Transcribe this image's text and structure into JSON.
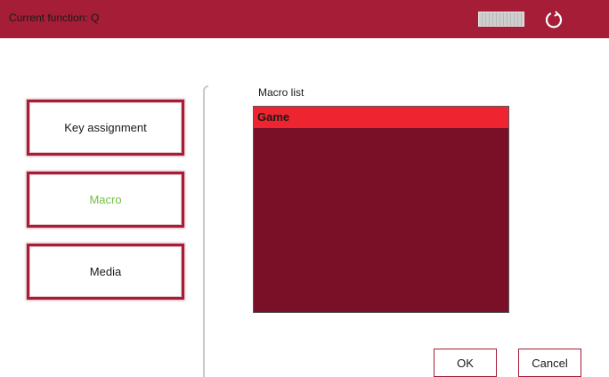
{
  "header": {
    "current_function_label": "Current function:  Q",
    "keyboard_icon": "keyboard-icon",
    "reset_icon": "refresh-icon"
  },
  "nav": {
    "items": [
      {
        "label": "Key assignment",
        "active": false
      },
      {
        "label": "Macro",
        "active": true
      },
      {
        "label": "Media",
        "active": false
      }
    ]
  },
  "macro_list": {
    "label": "Macro list",
    "items": [
      {
        "name": "Game",
        "selected": true
      }
    ]
  },
  "buttons": {
    "ok": "OK",
    "cancel": "Cancel"
  },
  "colors": {
    "header": "#a51d37",
    "list_background": "#7a0f28",
    "list_selected": "#ee2530",
    "active_text": "#6fc43e"
  }
}
